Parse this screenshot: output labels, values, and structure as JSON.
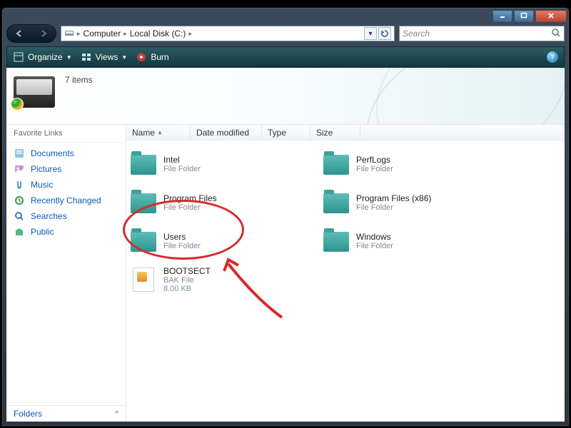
{
  "breadcrumb": {
    "root": "Computer",
    "drive": "Local Disk (C:)"
  },
  "search": {
    "placeholder": "Search"
  },
  "toolbar": {
    "organize": "Organize",
    "views": "Views",
    "burn": "Burn"
  },
  "header": {
    "count": "7 items"
  },
  "sidebar": {
    "heading": "Favorite Links",
    "items": [
      {
        "label": "Documents"
      },
      {
        "label": "Pictures"
      },
      {
        "label": "Music"
      },
      {
        "label": "Recently Changed"
      },
      {
        "label": "Searches"
      },
      {
        "label": "Public"
      }
    ],
    "folders": "Folders"
  },
  "columns": {
    "name": "Name",
    "modified": "Date modified",
    "type": "Type",
    "size": "Size"
  },
  "items": [
    {
      "name": "Intel",
      "sub": "File Folder",
      "kind": "folder"
    },
    {
      "name": "PerfLogs",
      "sub": "File Folder",
      "kind": "folder"
    },
    {
      "name": "Program Files",
      "sub": "File Folder",
      "kind": "folder"
    },
    {
      "name": "Program Files (x86)",
      "sub": "File Folder",
      "kind": "folder"
    },
    {
      "name": "Users",
      "sub": "File Folder",
      "kind": "folder"
    },
    {
      "name": "Windows",
      "sub": "File Folder",
      "kind": "folder"
    },
    {
      "name": "BOOTSECT",
      "sub": "BAK File",
      "size": "8.00 KB",
      "kind": "file"
    }
  ]
}
